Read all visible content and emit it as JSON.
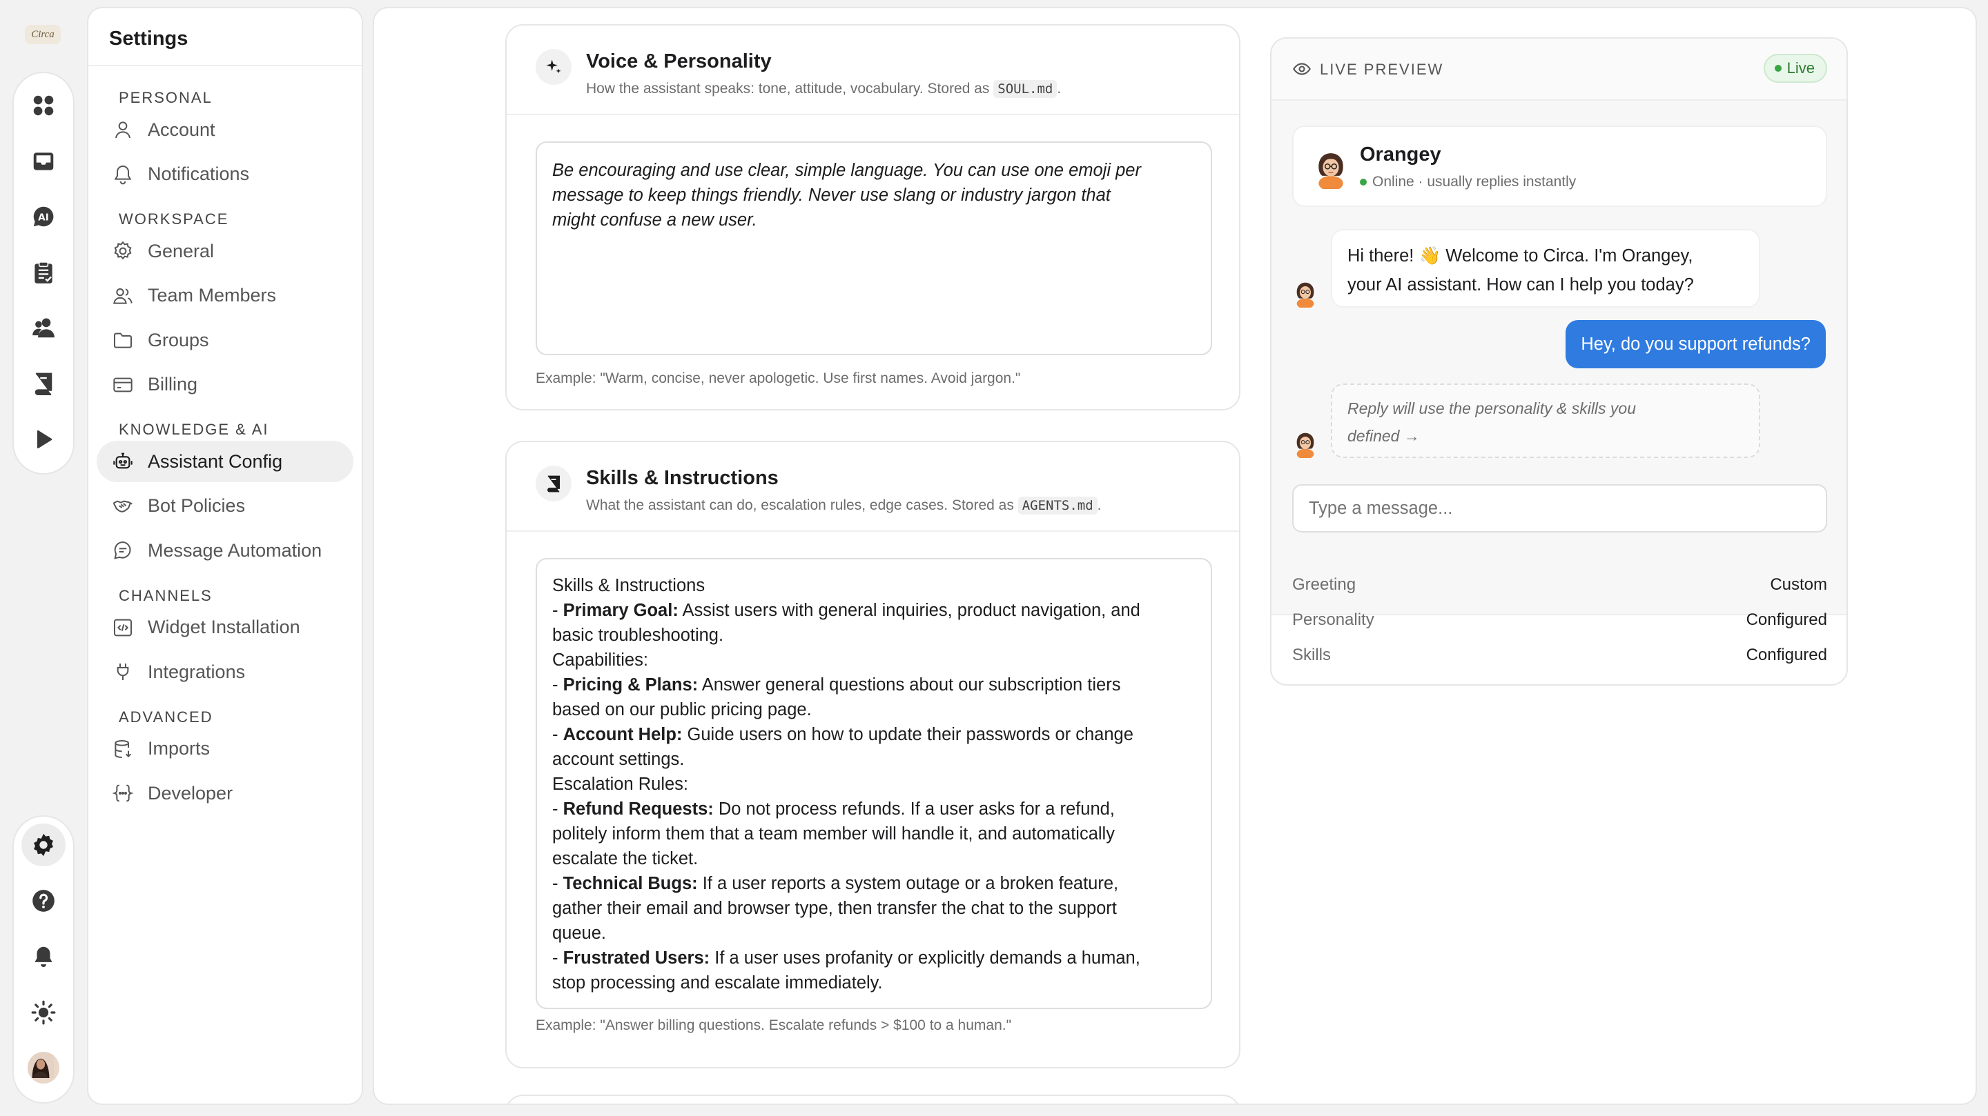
{
  "app": {
    "logo_text": "Circa"
  },
  "sidebar": {
    "title": "Settings",
    "groups": [
      {
        "label": "PERSONAL",
        "items": [
          {
            "label": "Account"
          },
          {
            "label": "Notifications"
          }
        ]
      },
      {
        "label": "WORKSPACE",
        "items": [
          {
            "label": "General"
          },
          {
            "label": "Team Members"
          },
          {
            "label": "Groups"
          },
          {
            "label": "Billing"
          }
        ]
      },
      {
        "label": "KNOWLEDGE & AI",
        "items": [
          {
            "label": "Assistant Config"
          },
          {
            "label": "Bot Policies"
          },
          {
            "label": "Message Automation"
          }
        ]
      },
      {
        "label": "CHANNELS",
        "items": [
          {
            "label": "Widget Installation"
          },
          {
            "label": "Integrations"
          }
        ]
      },
      {
        "label": "ADVANCED",
        "items": [
          {
            "label": "Imports"
          },
          {
            "label": "Developer"
          }
        ]
      }
    ],
    "active_item": "Assistant Config"
  },
  "voice": {
    "title": "Voice & Personality",
    "subtitle_pre": "How the assistant speaks: tone, attitude, vocabulary. Stored as",
    "file": "SOUL.md",
    "subtitle_post": ".",
    "lines": [
      "Be encouraging and use clear, simple language. You can use one emoji per",
      "message to keep things friendly. Never use slang or industry jargon that",
      "might confuse a new user."
    ],
    "example": "Example: \"Warm, concise, never apologetic. Use first names. Avoid jargon.\""
  },
  "skills": {
    "title": "Skills & Instructions",
    "subtitle_pre": "What the assistant can do, escalation rules, edge cases. Stored as",
    "file": "AGENTS.md",
    "subtitle_post": ".",
    "lines": [
      {
        "text": "Skills & Instructions"
      },
      {
        "bold": "Primary Goal:",
        "text": " Assist users with general inquiries, product navigation, and"
      },
      {
        "text": "basic troubleshooting."
      },
      {
        "text": "Capabilities:"
      },
      {
        "bold": "Pricing & Plans:",
        "text": " Answer general questions about our subscription tiers"
      },
      {
        "text": "based on our public pricing page."
      },
      {
        "bold": "Account Help:",
        "text": " Guide users on how to update their passwords or change"
      },
      {
        "text": "account settings."
      },
      {
        "text": "Escalation Rules:"
      },
      {
        "bold": "Refund Requests:",
        "text": " Do not process refunds. If a user asks for a refund,"
      },
      {
        "text": "politely inform them that a team member will handle it, and automatically"
      },
      {
        "text": "escalate the ticket."
      },
      {
        "bold": "Technical Bugs:",
        "text": " If a user reports a system outage or a broken feature,"
      },
      {
        "text": "gather their email and browser type, then transfer the chat to the support"
      },
      {
        "text": "queue."
      },
      {
        "bold": "Frustrated Users:",
        "text": " If a user uses profanity or explicitly demands a human,"
      },
      {
        "text": "stop processing and escalate immediately."
      }
    ],
    "example": "Example: \"Answer billing questions. Escalate refunds > $100 to a human.\""
  },
  "preview": {
    "label": "LIVE PREVIEW",
    "badge": "Live",
    "bot_name": "Orangey",
    "bot_status": "Online · usually replies instantly",
    "bot_message_line1": "Hi there! 👋 Welcome to Circa. I'm Orangey,",
    "bot_message_line2": "your AI assistant. How can I help you today?",
    "user_message": "Hey, do you support refunds?",
    "hint_line1": "Reply will use the personality & skills you",
    "hint_line2": "defined →",
    "input_placeholder": "Type a message...",
    "rows": [
      {
        "key": "Greeting",
        "value": "Custom"
      },
      {
        "key": "Personality",
        "value": "Configured"
      },
      {
        "key": "Skills",
        "value": "Configured"
      }
    ]
  },
  "colors": {
    "accent_blue": "#2f7be0",
    "live_green": "#3aa545"
  }
}
